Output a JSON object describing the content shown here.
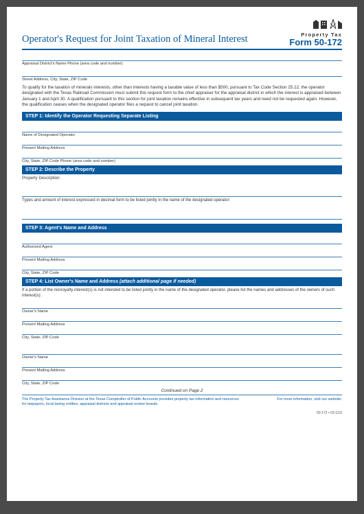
{
  "header": {
    "title": "Operator's Request for Joint Taxation of Mineral Interest",
    "propertyTax": "Property Tax",
    "formLabel": "Form",
    "formNumber": "50-172"
  },
  "topFields": {
    "appraisalPhone": "Appraisal District's Name Phone (area code and number)",
    "streetAddress": "Street Address, City, State, ZIP Code"
  },
  "intro": "To qualify for the taxation of minerals interests, other than interests having a taxable value of less than $500, pursuant to Tax Code Section 25.12, the operator designated with the Texas Railroad Commission must submit this request form to the chief appraiser for the appraisal district in which the interest is appraised between January 1 and April 30. A qualification pursuant to this section for joint taxation remains effective in subsequent tax years and need not be requested again. However, the qualification ceases when the designated operator files a request to cancel joint taxation.",
  "step1": {
    "heading": "STEP 1: Identify the Operator Requesting Separate Listing",
    "name": "Name of Designated Operator",
    "mailing": "Present Mailing Address",
    "cityPhone": "City, State, ZIP Code Phone (area code and number)"
  },
  "step2": {
    "heading": "STEP 2: Describe the Property",
    "propDesc": "Property Description:",
    "types": "Types and amount of interest expressed in decimal form to be listed jointly in the name of the designated operator:"
  },
  "step3": {
    "heading": "STEP 3: Agent's Name and Address",
    "agent": "Authorized Agent",
    "mailing": "Present Mailing Address",
    "city": "City, State, ZIP Code"
  },
  "step4": {
    "heading": "STEP 4: List Owner's Name and Address ",
    "headingItalic": "(attach additional page if needed)",
    "inst": "If a portion of the nonroyalty interest(s) is not intended to be listed jointly in the name of the designated operator, please list the names and addresses of the owners of such interest(s):",
    "ownerName": "Owner's Name",
    "mailing": "Present Mailing Address",
    "city": "City, State, ZIP Code"
  },
  "continued": "Continued on Page 2",
  "footer": {
    "left": "The Property Tax Assistance Division at the Texas Comptroller of Public Accounts provides property tax information and resources for taxpayers, local taxing entities, appraisal districts and appraisal review boards.",
    "right": "For more information, visit our website:",
    "version": "50-172 • 03-12/3"
  }
}
